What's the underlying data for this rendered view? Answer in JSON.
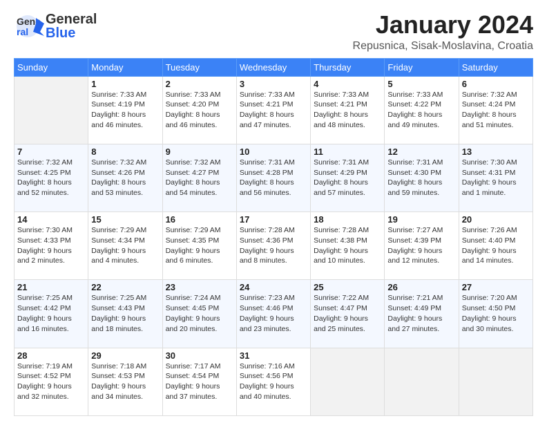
{
  "header": {
    "logo_general": "General",
    "logo_blue": "Blue",
    "month": "January 2024",
    "location": "Repusnica, Sisak-Moslavina, Croatia"
  },
  "days": [
    "Sunday",
    "Monday",
    "Tuesday",
    "Wednesday",
    "Thursday",
    "Friday",
    "Saturday"
  ],
  "weeks": [
    [
      {
        "date": "",
        "sunrise": "",
        "sunset": "",
        "daylight": ""
      },
      {
        "date": "1",
        "sunrise": "Sunrise: 7:33 AM",
        "sunset": "Sunset: 4:19 PM",
        "daylight": "Daylight: 8 hours and 46 minutes."
      },
      {
        "date": "2",
        "sunrise": "Sunrise: 7:33 AM",
        "sunset": "Sunset: 4:20 PM",
        "daylight": "Daylight: 8 hours and 46 minutes."
      },
      {
        "date": "3",
        "sunrise": "Sunrise: 7:33 AM",
        "sunset": "Sunset: 4:21 PM",
        "daylight": "Daylight: 8 hours and 47 minutes."
      },
      {
        "date": "4",
        "sunrise": "Sunrise: 7:33 AM",
        "sunset": "Sunset: 4:21 PM",
        "daylight": "Daylight: 8 hours and 48 minutes."
      },
      {
        "date": "5",
        "sunrise": "Sunrise: 7:33 AM",
        "sunset": "Sunset: 4:22 PM",
        "daylight": "Daylight: 8 hours and 49 minutes."
      },
      {
        "date": "6",
        "sunrise": "Sunrise: 7:32 AM",
        "sunset": "Sunset: 4:24 PM",
        "daylight": "Daylight: 8 hours and 51 minutes."
      }
    ],
    [
      {
        "date": "7",
        "sunrise": "Sunrise: 7:32 AM",
        "sunset": "Sunset: 4:25 PM",
        "daylight": "Daylight: 8 hours and 52 minutes."
      },
      {
        "date": "8",
        "sunrise": "Sunrise: 7:32 AM",
        "sunset": "Sunset: 4:26 PM",
        "daylight": "Daylight: 8 hours and 53 minutes."
      },
      {
        "date": "9",
        "sunrise": "Sunrise: 7:32 AM",
        "sunset": "Sunset: 4:27 PM",
        "daylight": "Daylight: 8 hours and 54 minutes."
      },
      {
        "date": "10",
        "sunrise": "Sunrise: 7:31 AM",
        "sunset": "Sunset: 4:28 PM",
        "daylight": "Daylight: 8 hours and 56 minutes."
      },
      {
        "date": "11",
        "sunrise": "Sunrise: 7:31 AM",
        "sunset": "Sunset: 4:29 PM",
        "daylight": "Daylight: 8 hours and 57 minutes."
      },
      {
        "date": "12",
        "sunrise": "Sunrise: 7:31 AM",
        "sunset": "Sunset: 4:30 PM",
        "daylight": "Daylight: 8 hours and 59 minutes."
      },
      {
        "date": "13",
        "sunrise": "Sunrise: 7:30 AM",
        "sunset": "Sunset: 4:31 PM",
        "daylight": "Daylight: 9 hours and 1 minute."
      }
    ],
    [
      {
        "date": "14",
        "sunrise": "Sunrise: 7:30 AM",
        "sunset": "Sunset: 4:33 PM",
        "daylight": "Daylight: 9 hours and 2 minutes."
      },
      {
        "date": "15",
        "sunrise": "Sunrise: 7:29 AM",
        "sunset": "Sunset: 4:34 PM",
        "daylight": "Daylight: 9 hours and 4 minutes."
      },
      {
        "date": "16",
        "sunrise": "Sunrise: 7:29 AM",
        "sunset": "Sunset: 4:35 PM",
        "daylight": "Daylight: 9 hours and 6 minutes."
      },
      {
        "date": "17",
        "sunrise": "Sunrise: 7:28 AM",
        "sunset": "Sunset: 4:36 PM",
        "daylight": "Daylight: 9 hours and 8 minutes."
      },
      {
        "date": "18",
        "sunrise": "Sunrise: 7:28 AM",
        "sunset": "Sunset: 4:38 PM",
        "daylight": "Daylight: 9 hours and 10 minutes."
      },
      {
        "date": "19",
        "sunrise": "Sunrise: 7:27 AM",
        "sunset": "Sunset: 4:39 PM",
        "daylight": "Daylight: 9 hours and 12 minutes."
      },
      {
        "date": "20",
        "sunrise": "Sunrise: 7:26 AM",
        "sunset": "Sunset: 4:40 PM",
        "daylight": "Daylight: 9 hours and 14 minutes."
      }
    ],
    [
      {
        "date": "21",
        "sunrise": "Sunrise: 7:25 AM",
        "sunset": "Sunset: 4:42 PM",
        "daylight": "Daylight: 9 hours and 16 minutes."
      },
      {
        "date": "22",
        "sunrise": "Sunrise: 7:25 AM",
        "sunset": "Sunset: 4:43 PM",
        "daylight": "Daylight: 9 hours and 18 minutes."
      },
      {
        "date": "23",
        "sunrise": "Sunrise: 7:24 AM",
        "sunset": "Sunset: 4:45 PM",
        "daylight": "Daylight: 9 hours and 20 minutes."
      },
      {
        "date": "24",
        "sunrise": "Sunrise: 7:23 AM",
        "sunset": "Sunset: 4:46 PM",
        "daylight": "Daylight: 9 hours and 23 minutes."
      },
      {
        "date": "25",
        "sunrise": "Sunrise: 7:22 AM",
        "sunset": "Sunset: 4:47 PM",
        "daylight": "Daylight: 9 hours and 25 minutes."
      },
      {
        "date": "26",
        "sunrise": "Sunrise: 7:21 AM",
        "sunset": "Sunset: 4:49 PM",
        "daylight": "Daylight: 9 hours and 27 minutes."
      },
      {
        "date": "27",
        "sunrise": "Sunrise: 7:20 AM",
        "sunset": "Sunset: 4:50 PM",
        "daylight": "Daylight: 9 hours and 30 minutes."
      }
    ],
    [
      {
        "date": "28",
        "sunrise": "Sunrise: 7:19 AM",
        "sunset": "Sunset: 4:52 PM",
        "daylight": "Daylight: 9 hours and 32 minutes."
      },
      {
        "date": "29",
        "sunrise": "Sunrise: 7:18 AM",
        "sunset": "Sunset: 4:53 PM",
        "daylight": "Daylight: 9 hours and 34 minutes."
      },
      {
        "date": "30",
        "sunrise": "Sunrise: 7:17 AM",
        "sunset": "Sunset: 4:54 PM",
        "daylight": "Daylight: 9 hours and 37 minutes."
      },
      {
        "date": "31",
        "sunrise": "Sunrise: 7:16 AM",
        "sunset": "Sunset: 4:56 PM",
        "daylight": "Daylight: 9 hours and 40 minutes."
      },
      {
        "date": "",
        "sunrise": "",
        "sunset": "",
        "daylight": ""
      },
      {
        "date": "",
        "sunrise": "",
        "sunset": "",
        "daylight": ""
      },
      {
        "date": "",
        "sunrise": "",
        "sunset": "",
        "daylight": ""
      }
    ]
  ]
}
